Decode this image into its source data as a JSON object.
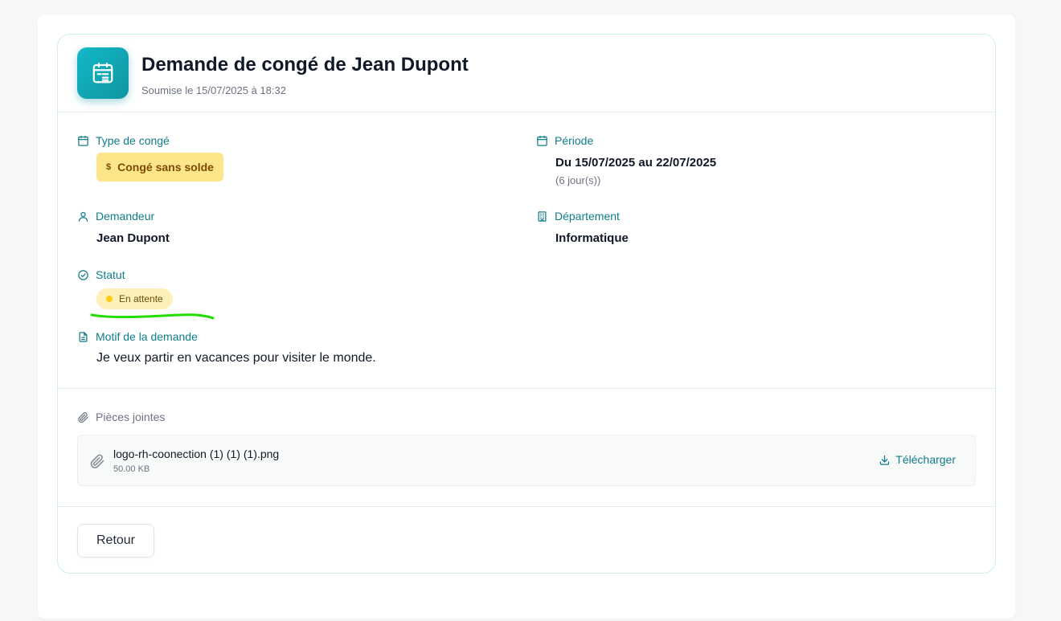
{
  "header": {
    "title": "Demande de congé de Jean Dupont",
    "submitted": "Soumise le 15/07/2025 à 18:32",
    "icon": "calendar-icon"
  },
  "fields": {
    "leave_type": {
      "label": "Type de congé",
      "value": "Congé sans solde",
      "value_icon": "$",
      "icon": "calendar-icon"
    },
    "period": {
      "label": "Période",
      "value": "Du 15/07/2025 au 22/07/2025",
      "duration": "(6 jour(s))",
      "icon": "calendar-icon"
    },
    "requester": {
      "label": "Demandeur",
      "value": "Jean Dupont",
      "icon": "user-icon"
    },
    "department": {
      "label": "Département",
      "value": "Informatique",
      "icon": "building-icon"
    },
    "status": {
      "label": "Statut",
      "value": "En attente",
      "icon": "check-circle-icon"
    },
    "reason": {
      "label": "Motif de la demande",
      "value": "Je veux partir en vacances pour visiter le monde.",
      "icon": "document-icon"
    }
  },
  "attachments": {
    "title": "Pièces jointes",
    "items": [
      {
        "name": "logo-rh-coonection (1) (1) (1).png",
        "size": "50.00 KB",
        "action": "Télécharger"
      }
    ]
  },
  "actions": {
    "back_label": "Retour"
  },
  "colors": {
    "accent": "#0f7c8a",
    "icon_gradient_start": "#14b8c8",
    "icon_gradient_end": "#0e96a0",
    "type_badge_bg": "#fde68a",
    "status_badge_bg": "#fdf0b8",
    "status_dot": "#facc15",
    "annotation_green": "#22dd00"
  }
}
